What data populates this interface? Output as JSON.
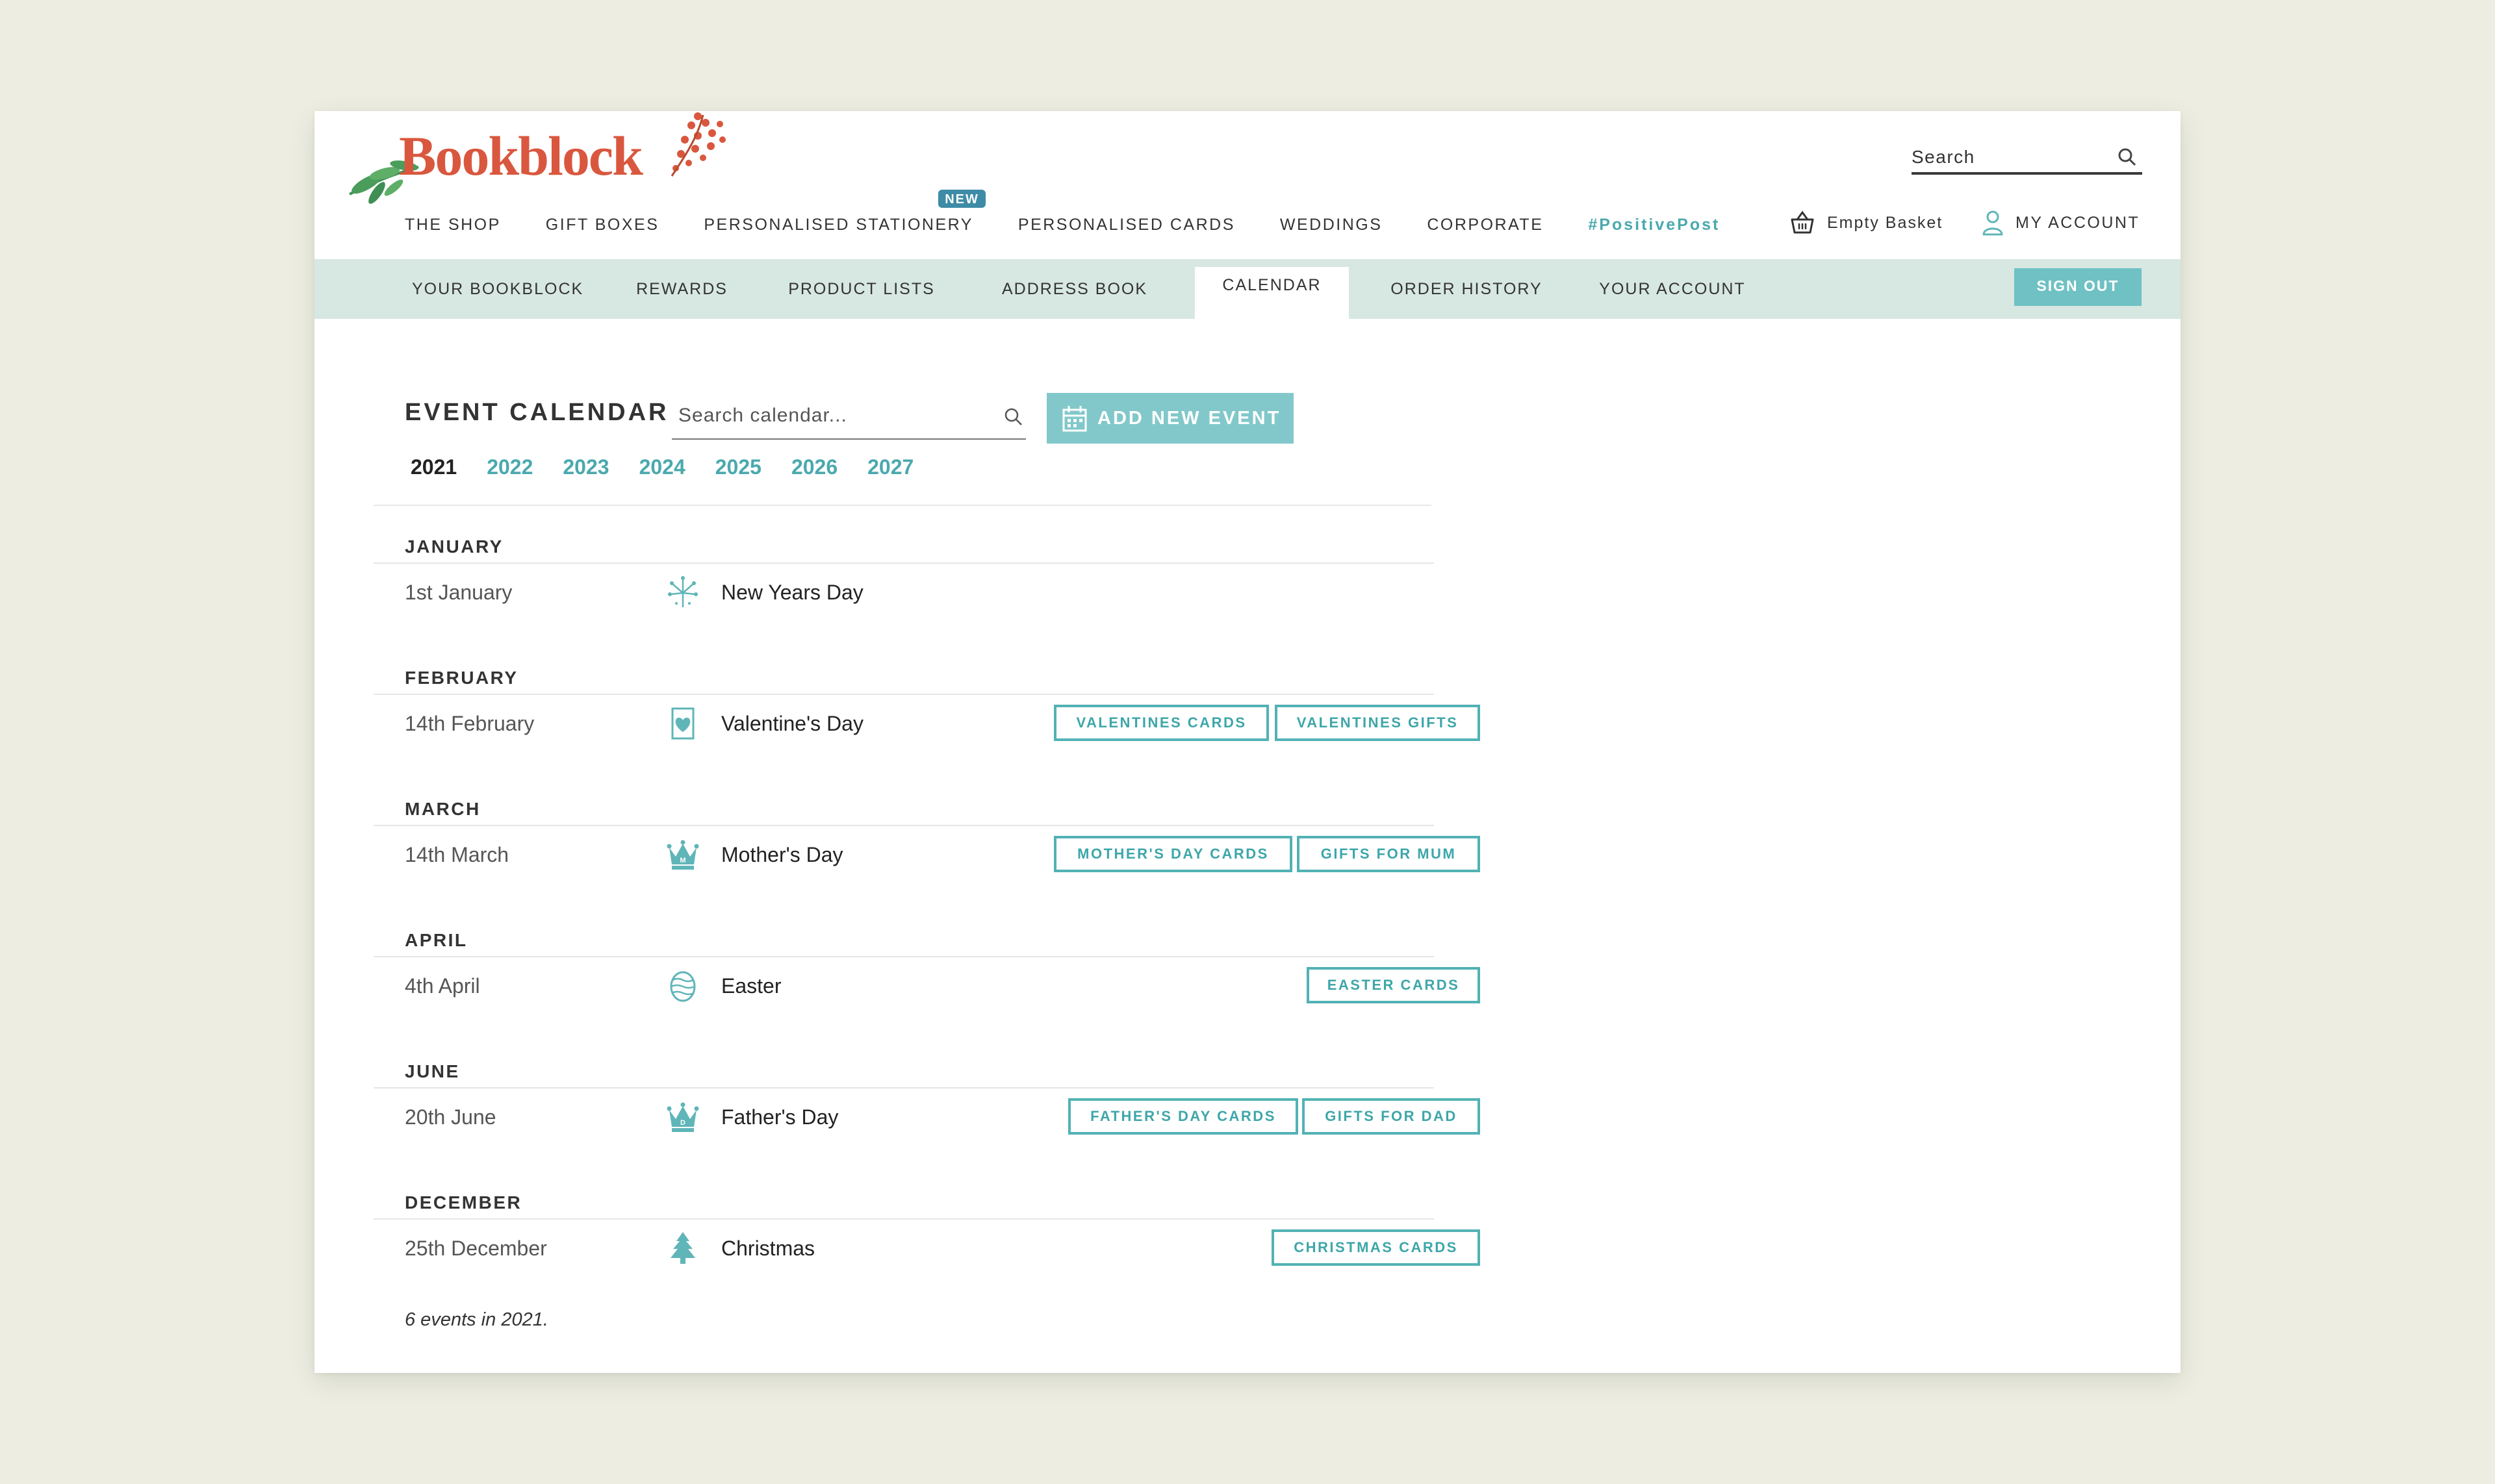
{
  "header": {
    "logo_text": "Bookblock",
    "search_placeholder": "Search",
    "nav": [
      "THE SHOP",
      "GIFT BOXES",
      "PERSONALISED STATIONERY",
      "PERSONALISED CARDS",
      "WEDDINGS",
      "CORPORATE",
      "#PositivePost"
    ],
    "new_badge": "NEW",
    "basket_label": "Empty Basket",
    "account_label": "MY ACCOUNT"
  },
  "subnav": {
    "items": [
      "YOUR BOOKBLOCK",
      "REWARDS",
      "PRODUCT LISTS",
      "ADDRESS BOOK",
      "CALENDAR",
      "ORDER HISTORY",
      "YOUR ACCOUNT"
    ],
    "active": "CALENDAR",
    "signout_label": "SIGN OUT"
  },
  "calendar": {
    "title": "EVENT CALENDAR",
    "search_placeholder": "Search calendar...",
    "add_button": "ADD NEW EVENT",
    "years": [
      "2021",
      "2022",
      "2023",
      "2024",
      "2025",
      "2026",
      "2027"
    ],
    "current_year": "2021",
    "months": [
      {
        "month": "JANUARY",
        "date": "1st January",
        "event": "New Years Day",
        "icon": "fireworks-icon",
        "tags": []
      },
      {
        "month": "FEBRUARY",
        "date": "14th February",
        "event": "Valentine's Day",
        "icon": "heart-card-icon",
        "tags": [
          "VALENTINES CARDS",
          "VALENTINES GIFTS"
        ]
      },
      {
        "month": "MARCH",
        "date": "14th March",
        "event": "Mother's Day",
        "icon": "crown-icon",
        "tags": [
          "MOTHER'S DAY CARDS",
          "GIFTS FOR MUM"
        ]
      },
      {
        "month": "APRIL",
        "date": "4th April",
        "event": "Easter",
        "icon": "easter-egg-icon",
        "tags": [
          "EASTER CARDS"
        ]
      },
      {
        "month": "JUNE",
        "date": "20th June",
        "event": "Father's Day",
        "icon": "crown-icon",
        "tags": [
          "FATHER'S DAY CARDS",
          "GIFTS FOR DAD"
        ]
      },
      {
        "month": "DECEMBER",
        "date": "25th December",
        "event": "Christmas",
        "icon": "christmas-tree-icon",
        "tags": [
          "CHRISTMAS CARDS"
        ]
      }
    ],
    "summary": "6 events in 2021."
  },
  "colors": {
    "background": "#edeee1",
    "accent": "#4aa9ae",
    "subnav_bg": "#d7e7e2",
    "button_bg": "#82c8ca",
    "logo_red": "#d9573e",
    "new_badge": "#3d8ba6"
  }
}
